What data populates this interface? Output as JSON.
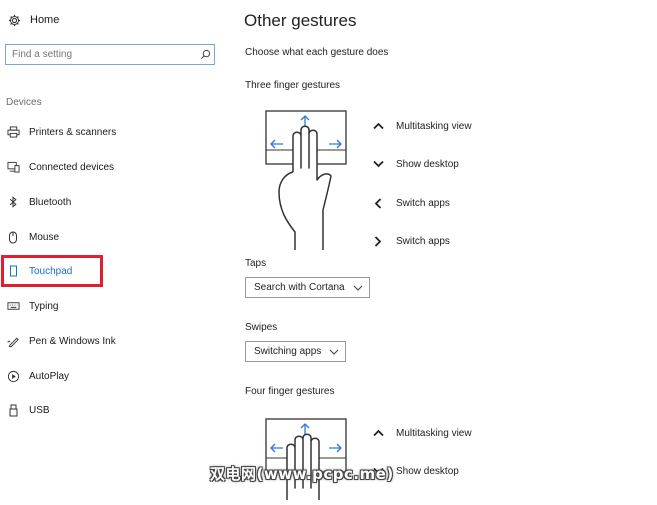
{
  "sidebar": {
    "home_label": "Home",
    "search_placeholder": "Find a setting",
    "section_label": "Devices",
    "items": [
      {
        "label": "Printers & scanners",
        "icon": "printer-icon"
      },
      {
        "label": "Connected devices",
        "icon": "connected-devices-icon"
      },
      {
        "label": "Bluetooth",
        "icon": "bluetooth-icon"
      },
      {
        "label": "Mouse",
        "icon": "mouse-icon"
      },
      {
        "label": "Touchpad",
        "icon": "touchpad-icon",
        "active": true
      },
      {
        "label": "Typing",
        "icon": "keyboard-icon"
      },
      {
        "label": "Pen & Windows Ink",
        "icon": "pen-icon"
      },
      {
        "label": "AutoPlay",
        "icon": "autoplay-icon"
      },
      {
        "label": "USB",
        "icon": "usb-icon"
      }
    ]
  },
  "main": {
    "title": "Other gestures",
    "subtitle": "Choose what each gesture does",
    "three_finger": {
      "title": "Three finger gestures",
      "gestures": [
        {
          "direction": "up",
          "label": "Multitasking view"
        },
        {
          "direction": "down",
          "label": "Show desktop"
        },
        {
          "direction": "left",
          "label": "Switch apps"
        },
        {
          "direction": "right",
          "label": "Switch apps"
        }
      ],
      "taps_label": "Taps",
      "taps_value": "Search with Cortana",
      "swipes_label": "Swipes",
      "swipes_value": "Switching apps"
    },
    "four_finger": {
      "title": "Four finger gestures",
      "gestures": [
        {
          "direction": "up",
          "label": "Multitasking view"
        },
        {
          "direction": "down",
          "label": "Show desktop"
        }
      ]
    }
  },
  "watermark": "双电网(www.pcpc.me)",
  "colors": {
    "accent": "#1a6fc4",
    "highlight": "#e11d2e",
    "arrow_blue": "#2b7bd6"
  }
}
